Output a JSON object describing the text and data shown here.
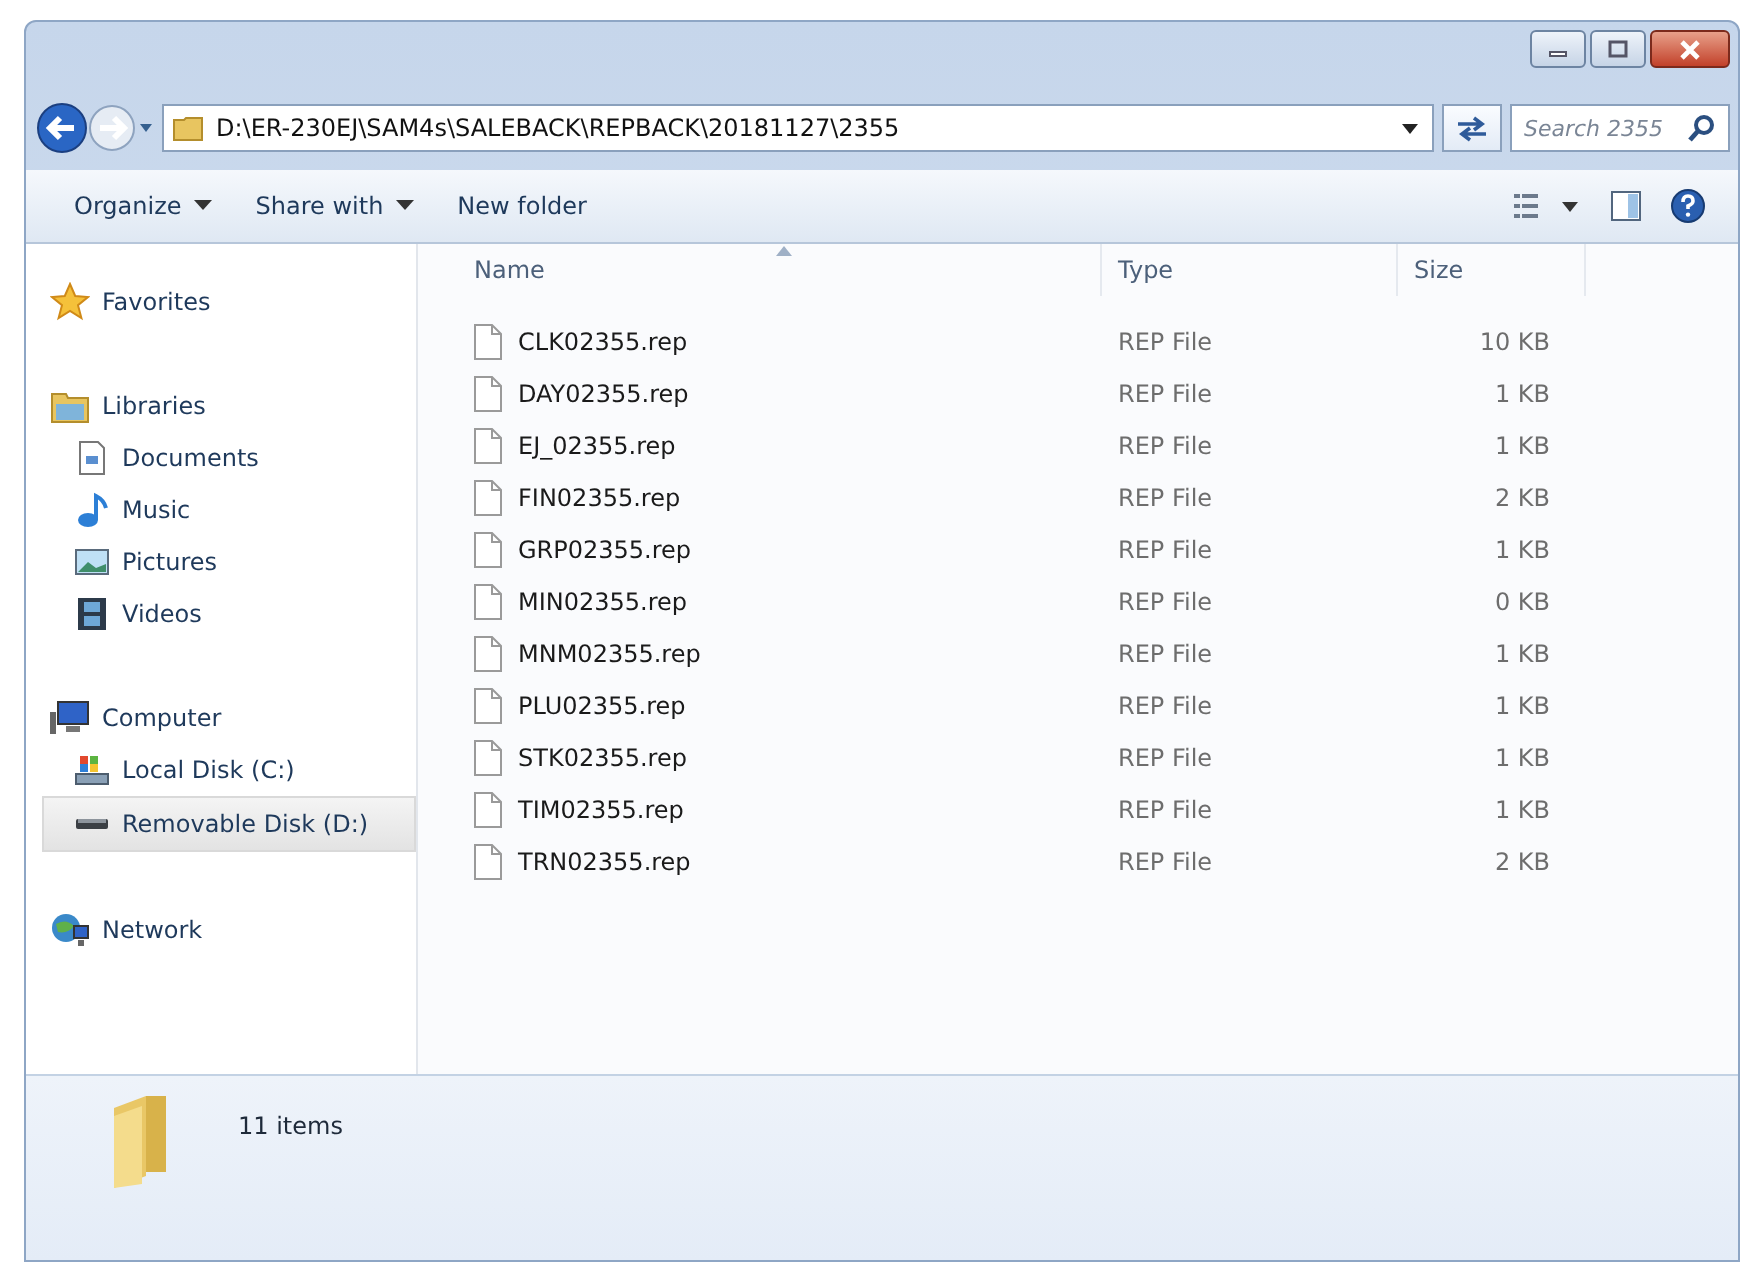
{
  "address_bar": {
    "path": "D:\\ER-230EJ\\SAM4s\\SALEBACK\\REPBACK\\20181127\\2355"
  },
  "search": {
    "placeholder": "Search 2355"
  },
  "toolbar": {
    "items": [
      {
        "label": "Organize",
        "dropdown": true
      },
      {
        "label": "Share with",
        "dropdown": true
      },
      {
        "label": "New folder",
        "dropdown": false
      }
    ]
  },
  "sidebar": {
    "groups": [
      {
        "label": "Favorites",
        "kind": "favorites",
        "selected": false
      },
      {
        "label": "Libraries",
        "kind": "libraries",
        "selected": false,
        "children": [
          {
            "label": "Documents",
            "kind": "documents",
            "selected": false
          },
          {
            "label": "Music",
            "kind": "music",
            "selected": false
          },
          {
            "label": "Pictures",
            "kind": "pictures",
            "selected": false
          },
          {
            "label": "Videos",
            "kind": "videos",
            "selected": false
          }
        ]
      },
      {
        "label": "Computer",
        "kind": "computer",
        "selected": false,
        "children": [
          {
            "label": "Local Disk (C:)",
            "kind": "disk",
            "selected": false
          },
          {
            "label": "Removable Disk (D:)",
            "kind": "removable",
            "selected": true
          }
        ]
      },
      {
        "label": "Network",
        "kind": "network",
        "selected": false
      }
    ]
  },
  "table": {
    "columns": [
      {
        "label": "Name",
        "sorted": true
      },
      {
        "label": "Type",
        "sorted": false
      },
      {
        "label": "Size",
        "sorted": false
      }
    ],
    "rows": [
      {
        "name": "CLK02355.rep",
        "type": "REP File",
        "size": "10 KB"
      },
      {
        "name": "DAY02355.rep",
        "type": "REP File",
        "size": "1 KB"
      },
      {
        "name": "EJ_02355.rep",
        "type": "REP File",
        "size": "1 KB"
      },
      {
        "name": "FIN02355.rep",
        "type": "REP File",
        "size": "2 KB"
      },
      {
        "name": "GRP02355.rep",
        "type": "REP File",
        "size": "1 KB"
      },
      {
        "name": "MIN02355.rep",
        "type": "REP File",
        "size": "0 KB"
      },
      {
        "name": "MNM02355.rep",
        "type": "REP File",
        "size": "1 KB"
      },
      {
        "name": "PLU02355.rep",
        "type": "REP File",
        "size": "1 KB"
      },
      {
        "name": "STK02355.rep",
        "type": "REP File",
        "size": "1 KB"
      },
      {
        "name": "TIM02355.rep",
        "type": "REP File",
        "size": "1 KB"
      },
      {
        "name": "TRN02355.rep",
        "type": "REP File",
        "size": "2 KB"
      }
    ]
  },
  "status_bar": {
    "count": "11 items"
  }
}
